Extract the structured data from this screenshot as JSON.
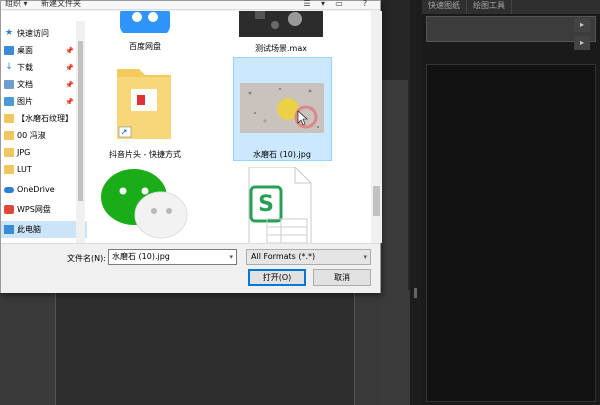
{
  "dialog": {
    "toolbar": {
      "organize": "组织 ▾",
      "new_folder": "新建文件夹"
    },
    "nav": [
      {
        "label": "快速访问",
        "icon": "star-icon",
        "pinned": false
      },
      {
        "label": "桌面",
        "icon": "desktop-folder-icon",
        "pinned": true
      },
      {
        "label": "下载",
        "icon": "download-icon",
        "pinned": true
      },
      {
        "label": "文档",
        "icon": "document-icon",
        "pinned": true
      },
      {
        "label": "图片",
        "icon": "picture-icon",
        "pinned": true
      },
      {
        "label": "【水磨石纹理】",
        "icon": "folder-icon",
        "pinned": false
      },
      {
        "label": "00 冯淑",
        "icon": "folder-icon",
        "pinned": false
      },
      {
        "label": "JPG",
        "icon": "folder-icon",
        "pinned": false
      },
      {
        "label": "LUT",
        "icon": "folder-icon",
        "pinned": false
      },
      {
        "label": "OneDrive",
        "icon": "cloud-icon",
        "pinned": false
      },
      {
        "label": "WPS网盘",
        "icon": "wps-icon",
        "pinned": false
      },
      {
        "label": "此电脑",
        "icon": "pc-icon",
        "pinned": false
      }
    ],
    "files": [
      {
        "label": "百度网盘",
        "icon": "baidu-netdisk-icon"
      },
      {
        "label": "测试场景.max",
        "icon": "max-file-icon"
      },
      {
        "label": "抖音片头 - 快捷方式",
        "icon": "shortcut-folder-icon"
      },
      {
        "label": "水磨石 (10).jpg",
        "icon": "terrazzo-image-thumbnail",
        "selected": true
      },
      {
        "label": "",
        "icon": "wechat-icon"
      },
      {
        "label": "",
        "icon": "wps-sheet-icon"
      }
    ],
    "filename_label": "文件名(N):",
    "filename_value": "水磨石 (10).jpg",
    "format_value": "All Formats (*.*)",
    "open_button": "打开(O)",
    "cancel_button": "取消"
  },
  "background_panel": {
    "tabs": [
      "快速图纸",
      "绘图工具"
    ]
  },
  "colors": {
    "selection": "#cce8ff",
    "accent": "#0078d7",
    "dark_bg": "#262626"
  }
}
